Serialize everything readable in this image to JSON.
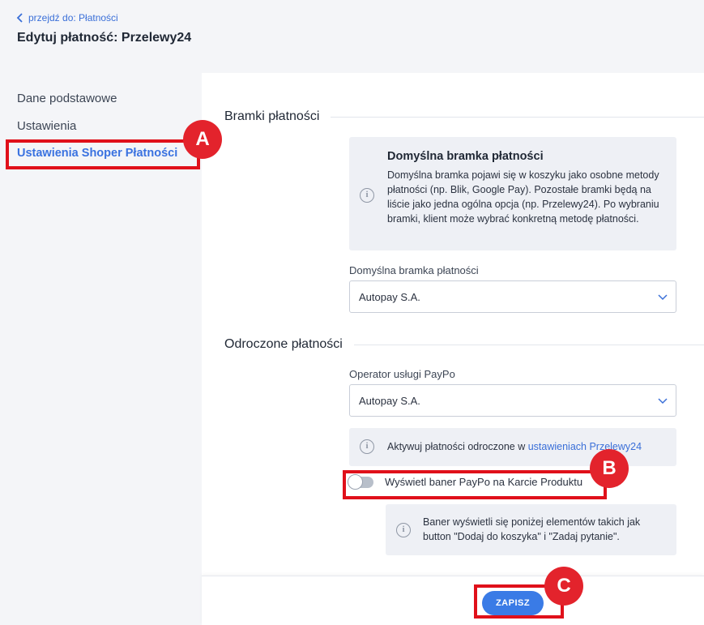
{
  "header": {
    "back_link": "przejdź do: Płatności",
    "title": "Edytuj płatność: Przelewy24"
  },
  "sidebar": {
    "items": [
      {
        "label": "Dane podstawowe"
      },
      {
        "label": "Ustawienia"
      },
      {
        "label": "Ustawienia Shoper Płatności",
        "active": true
      }
    ]
  },
  "sections": {
    "gateways": {
      "title": "Bramki płatności",
      "info_title": "Domyślna bramka płatności",
      "info_text": "Domyślna bramka pojawi się w koszyku jako osobne metody płatności (np. Blik, Google Pay). Pozostałe bramki będą na liście jako jedna ogólna opcja (np. Przelewy24). Po wybraniu bramki, klient może wybrać konkretną metodę płatności.",
      "field_label": "Domyślna bramka płatności",
      "field_value": "Autopay S.A."
    },
    "deferred": {
      "title": "Odroczone płatności",
      "field_label": "Operator usługi PayPo",
      "field_value": "Autopay S.A.",
      "info_text": "Aktywuj płatności odroczone w ",
      "info_link": "ustawieniach Przelewy24",
      "toggle_label": "Wyświetl baner PayPo na Karcie Produktu",
      "toggle_on": false,
      "banner_info": "Baner wyświetli się poniżej elementów takich jak button \"Dodaj do koszyka\" i \"Zadaj pytanie\"."
    }
  },
  "footer": {
    "save_label": "ZAPISZ"
  },
  "annotations": {
    "marker_a": "A",
    "marker_b": "B",
    "marker_c": "C",
    "highlight_color": "#e0101a"
  },
  "colors": {
    "accent": "#3a7be6",
    "link": "#3a6fd8",
    "marker": "#e3232c"
  }
}
